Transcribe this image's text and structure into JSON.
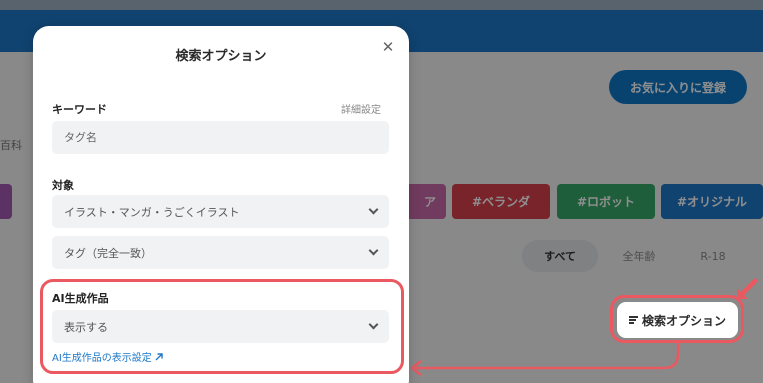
{
  "background": {
    "favorite_button": "お気に入りに登録",
    "side_text": "百科",
    "tags": {
      "partial": "ア",
      "veranda": "#ベランダ",
      "robot": "#ロボット",
      "original": "#オリジナル"
    },
    "age_filters": {
      "all": "すべて",
      "general": "全年齢",
      "r18": "R-18"
    },
    "search_option_button": "検索オプション"
  },
  "modal": {
    "title": "検索オプション",
    "close": "✕",
    "keyword": {
      "label": "キーワード",
      "detail_link": "詳細設定",
      "placeholder": "タグ名"
    },
    "target": {
      "label": "対象",
      "type_select": "イラスト・マンガ・うごくイラスト",
      "match_select": "タグ（完全一致）"
    },
    "ai": {
      "label": "AI生成作品",
      "select": "表示する",
      "settings_link": "AI生成作品の表示設定"
    }
  },
  "colors": {
    "accent_blue": "#1d78c8",
    "highlight_red": "#ea5860"
  }
}
